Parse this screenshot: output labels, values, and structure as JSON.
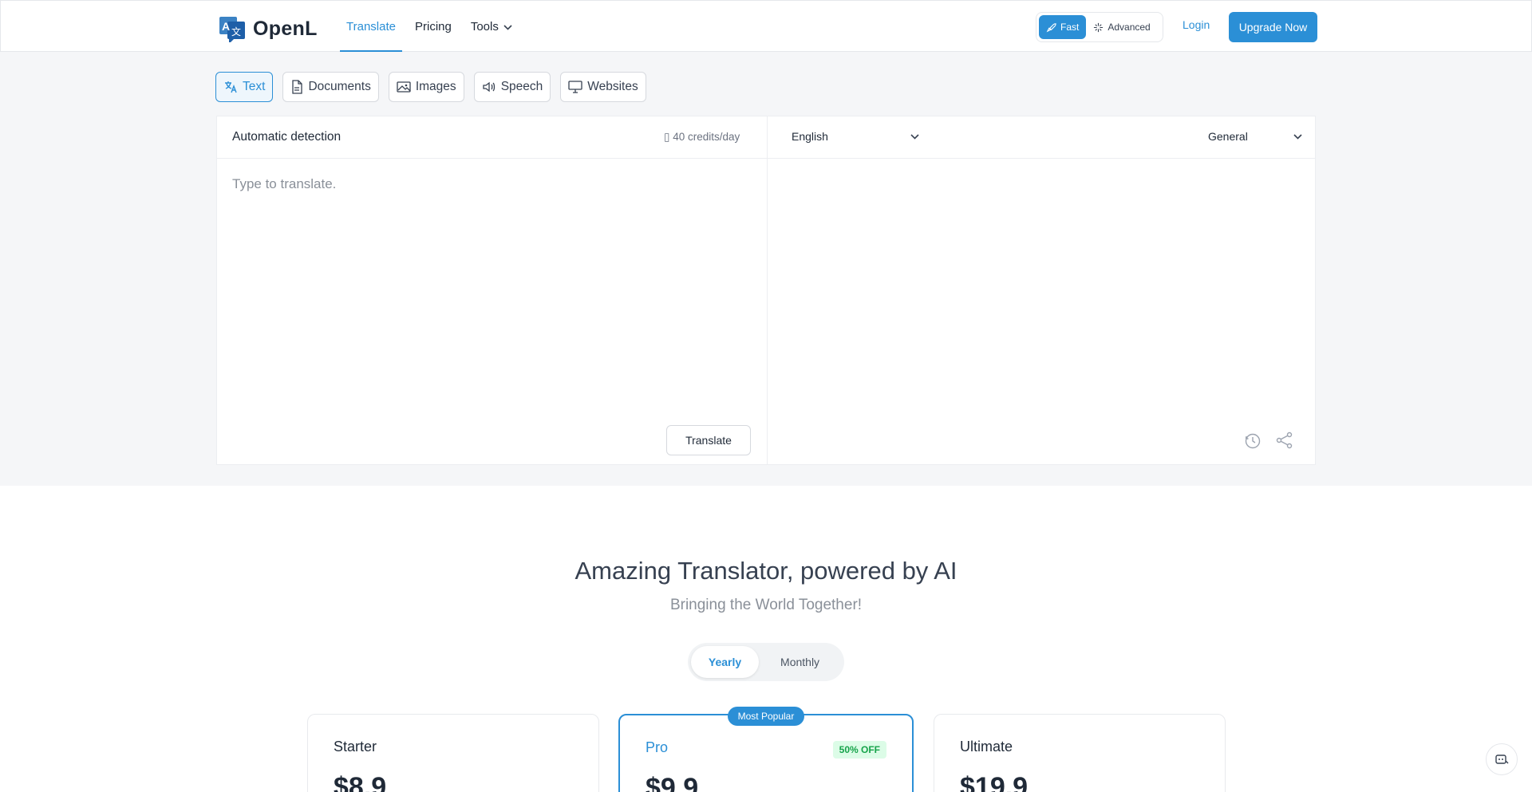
{
  "header": {
    "brand": "OpenL",
    "nav": [
      {
        "label": "Translate",
        "active": true
      },
      {
        "label": "Pricing",
        "active": false
      },
      {
        "label": "Tools",
        "active": false
      }
    ],
    "modes": {
      "fast": "Fast",
      "advanced": "Advanced"
    },
    "login": "Login",
    "upgrade": "Upgrade Now"
  },
  "tabs": [
    {
      "label": "Text",
      "icon": "translate-icon",
      "active": true
    },
    {
      "label": "Documents",
      "icon": "document-icon",
      "active": false
    },
    {
      "label": "Images",
      "icon": "image-icon",
      "active": false
    },
    {
      "label": "Speech",
      "icon": "speaker-icon",
      "active": false
    },
    {
      "label": "Websites",
      "icon": "monitor-icon",
      "active": false
    }
  ],
  "translator": {
    "source_language": "Automatic detection",
    "credits": "40 credits/day",
    "placeholder": "Type to translate.",
    "translate_button": "Translate",
    "target_language": "English",
    "domain": "General"
  },
  "hero": {
    "title": "Amazing Translator, powered by AI",
    "subtitle": "Bringing the World Together!"
  },
  "billing": {
    "yearly": "Yearly",
    "monthly": "Monthly",
    "selected": "Yearly"
  },
  "plans": [
    {
      "name": "Starter",
      "price": "$8.9"
    },
    {
      "name": "Pro",
      "price": "$9.9",
      "badge": "Most Popular",
      "discount": "50% OFF"
    },
    {
      "name": "Ultimate",
      "price": "$19.9"
    }
  ],
  "colors": {
    "accent": "#2b8fd6",
    "band": "#f5f6f8",
    "discount_bg": "#dcfce7",
    "discount_text": "#16a34a"
  }
}
